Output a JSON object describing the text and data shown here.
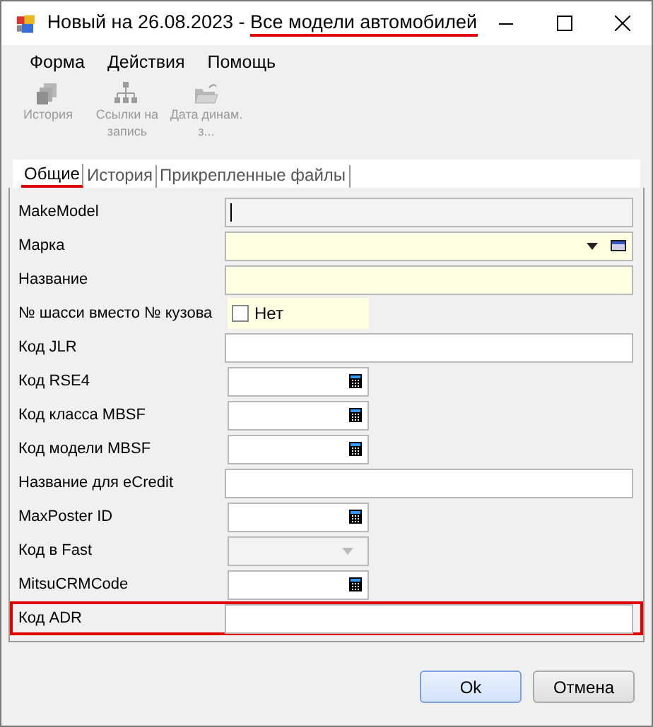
{
  "window": {
    "title": [
      {
        "text": "Новый на 26.08.2023 -",
        "underlined": false
      },
      {
        "text": "Все модели автомобилей",
        "underlined": true
      }
    ]
  },
  "menu": [
    "Форма",
    "Действия",
    "Помощь"
  ],
  "toolbar": [
    {
      "kind": "history",
      "label": "История",
      "disabled": true
    },
    {
      "kind": "links",
      "label": "Ссылки на запись",
      "disabled": true
    },
    {
      "kind": "folder",
      "label": "Дата динам. з...",
      "disabled": true
    }
  ],
  "tabs": [
    {
      "label": "Общие",
      "selected": true
    },
    {
      "label": "История",
      "selected": false
    },
    {
      "label": "Прикрепленные файлы",
      "selected": false
    }
  ],
  "fields": [
    {
      "label": "MakeModel",
      "kind": "text",
      "short": false,
      "disabled": true
    },
    {
      "label": "Марка",
      "kind": "lookup",
      "short": false,
      "required": true
    },
    {
      "label": "Название",
      "kind": "text",
      "short": false,
      "required": true
    },
    {
      "label": "№ шасси вместо № кузова",
      "kind": "checkbox",
      "value": "Нет",
      "checked": false,
      "required": true
    },
    {
      "label": "Код JLR",
      "kind": "text",
      "short": false
    },
    {
      "label": "Код RSE4",
      "kind": "number",
      "short": true
    },
    {
      "label": "Код класса MBSF",
      "kind": "number",
      "short": true
    },
    {
      "label": "Код модели MBSF",
      "kind": "number",
      "short": true
    },
    {
      "label": "Название для eCredit",
      "kind": "text",
      "short": false
    },
    {
      "label": "MaxPoster ID",
      "kind": "number",
      "short": true
    },
    {
      "label": "Код в Fast",
      "kind": "select",
      "short": true,
      "disabled": true
    },
    {
      "label": "MitsuCRMCode",
      "kind": "number",
      "short": true
    },
    {
      "label": "Код ADR",
      "kind": "text",
      "short": false,
      "highlighted": true
    }
  ],
  "buttons": [
    {
      "label": "Ok",
      "default": true
    },
    {
      "label": "Отмена",
      "default": false
    }
  ]
}
